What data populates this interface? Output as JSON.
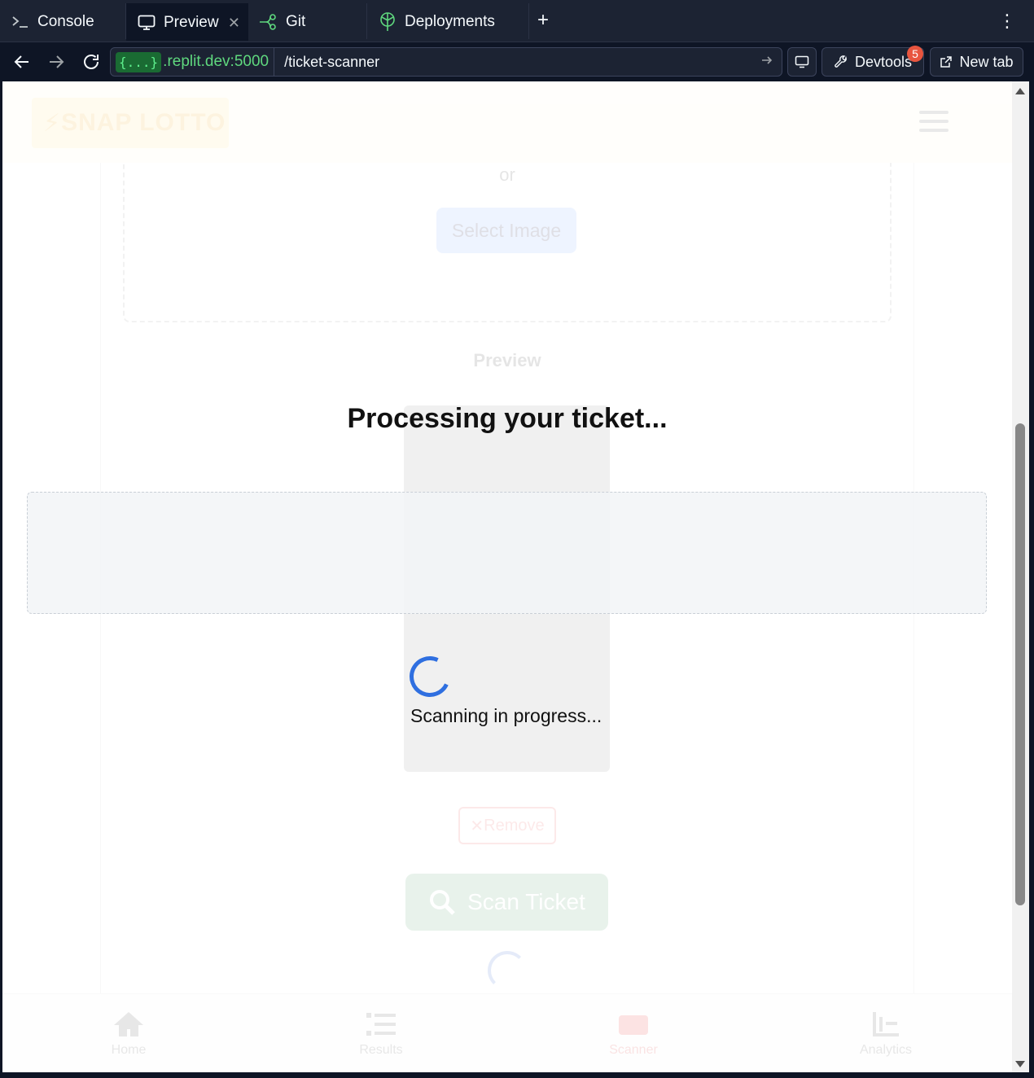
{
  "tabs": [
    {
      "label": "Console",
      "icon": "terminal-icon"
    },
    {
      "label": "Preview",
      "icon": "monitor-icon",
      "active": true
    },
    {
      "label": "Git",
      "icon": "git-branch-icon"
    },
    {
      "label": "Deployments",
      "icon": "deployments-icon"
    }
  ],
  "address": {
    "badge": "{...}",
    "host": ".replit.dev:5000",
    "path": "/ticket-scanner"
  },
  "toolbar": {
    "devtools_label": "Devtools",
    "devtools_badge": "5",
    "new_tab_label": "New tab"
  },
  "app": {
    "logo": "SNAP LOTTO",
    "or_text": "or",
    "select_image": "Select Image",
    "preview_title": "Preview",
    "remove_label": "Remove",
    "scan_ticket": "Scan Ticket",
    "nav": [
      {
        "label": "Home",
        "icon": "home-icon"
      },
      {
        "label": "Results",
        "icon": "list-icon"
      },
      {
        "label": "Scanner",
        "icon": "scanner-icon",
        "active": true
      },
      {
        "label": "Analytics",
        "icon": "analytics-icon"
      }
    ]
  },
  "overlay": {
    "title": "Processing your ticket...",
    "status": "Scanning in progress..."
  },
  "colors": {
    "chrome_bg": "#1c2333",
    "accent_green": "#5fd87e",
    "spinner_blue": "#2f6fe0",
    "badge_red": "#e8553f"
  }
}
